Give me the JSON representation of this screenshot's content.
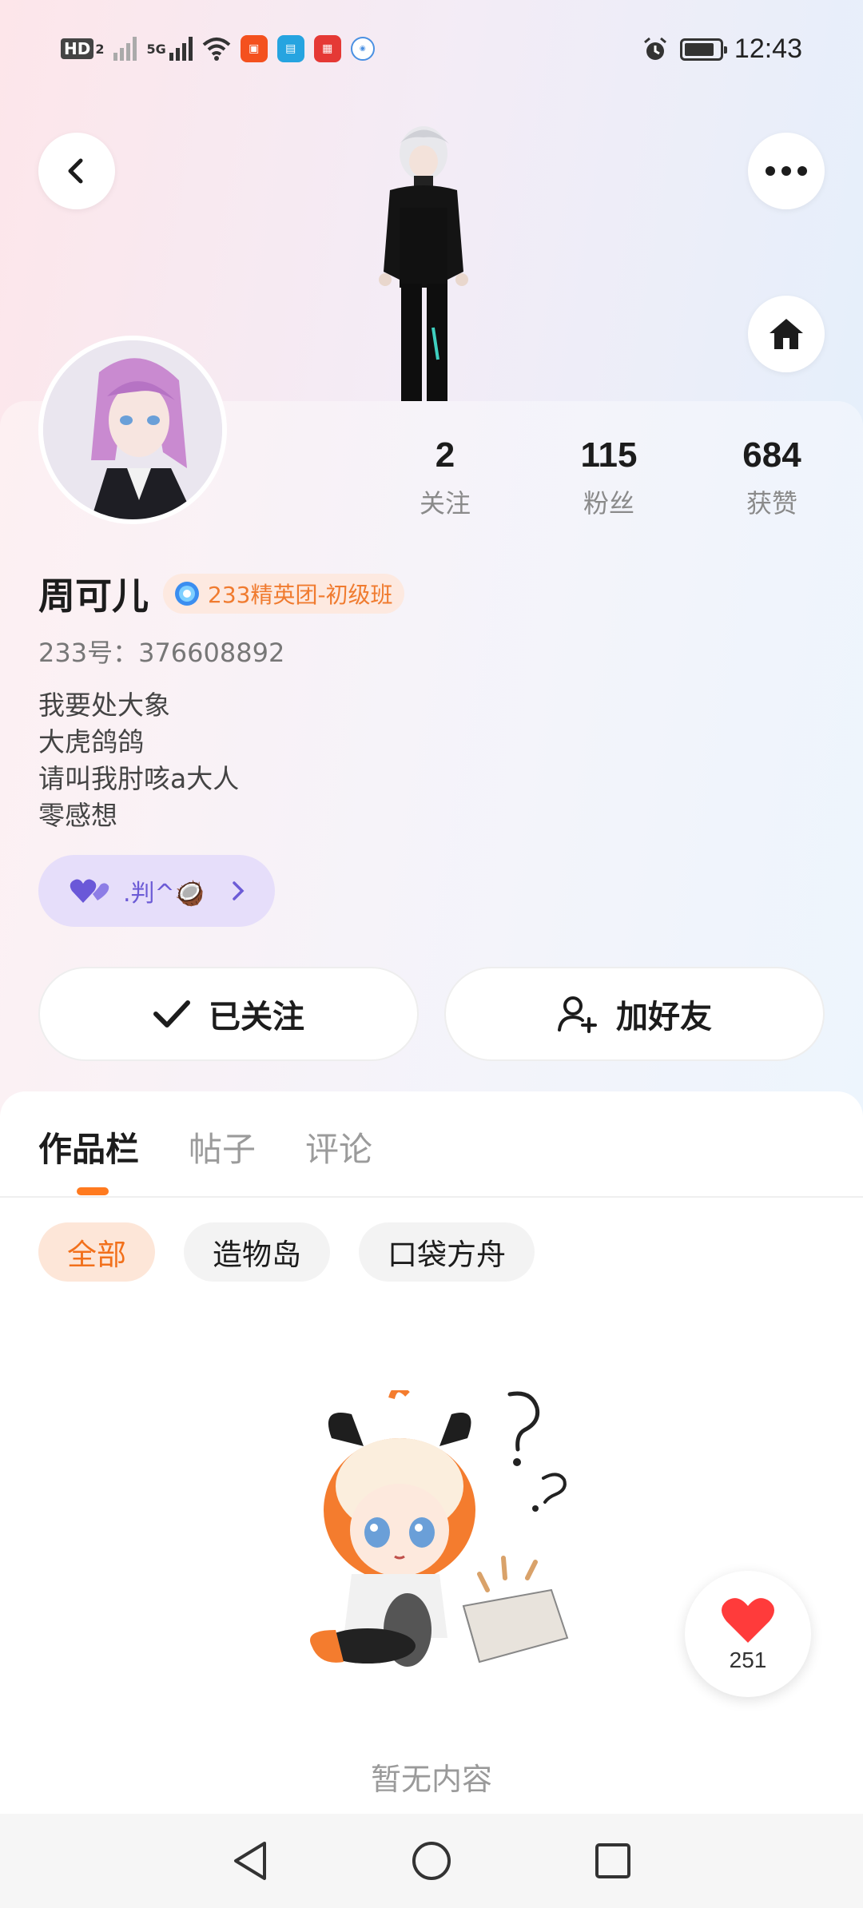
{
  "status_bar": {
    "network_tags": [
      "HD",
      "2",
      "5G"
    ],
    "app_icons": [
      {
        "name": "app-icon-1",
        "color": "#f4511e"
      },
      {
        "name": "app-icon-2",
        "color": "#26a4e0"
      },
      {
        "name": "huawei-icon",
        "color": "#e53935"
      },
      {
        "name": "ifly-icon",
        "color": "#4a90e2"
      }
    ],
    "time": "12:43"
  },
  "header": {
    "back_icon": "chevron-left-icon",
    "more_icon": "more-horizontal-icon",
    "home_icon": "home-icon"
  },
  "profile": {
    "name": "周可儿",
    "badge": "233精英团-初级班",
    "uid": "233号：376608892",
    "bio": [
      "我要处大象",
      "大虎鸽鸽",
      "请叫我肘咳a大人",
      "零感想"
    ],
    "fan_chip": ".判^🥥"
  },
  "stats": [
    {
      "value": "2",
      "label": "关注"
    },
    {
      "value": "115",
      "label": "粉丝"
    },
    {
      "value": "684",
      "label": "获赞"
    }
  ],
  "actions": {
    "follow": "已关注",
    "add_friend": "加好友"
  },
  "tabs": [
    "作品栏",
    "帖子",
    "评论"
  ],
  "active_tab": 0,
  "filters": [
    "全部",
    "造物岛",
    "口袋方舟"
  ],
  "active_filter": 0,
  "empty_text": "暂无内容",
  "like": {
    "count": "251"
  },
  "colors": {
    "accent": "#ff7a1f",
    "chip_active_bg": "#fde6d8",
    "fan_chip_bg": "#e6defa",
    "like_red": "#ff3b3b"
  }
}
